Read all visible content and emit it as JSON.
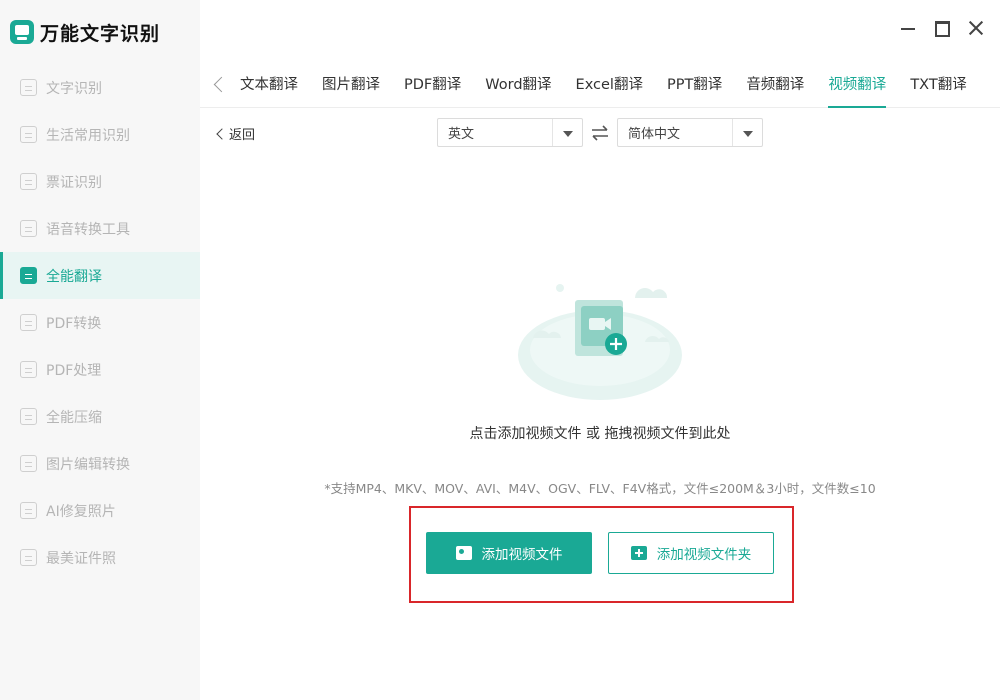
{
  "app": {
    "title": "万能文字识别"
  },
  "sidebar": {
    "items": [
      {
        "label": "文字识别",
        "active": false
      },
      {
        "label": "生活常用识别",
        "active": false
      },
      {
        "label": "票证识别",
        "active": false
      },
      {
        "label": "语音转换工具",
        "active": false
      },
      {
        "label": "全能翻译",
        "active": true
      },
      {
        "label": "PDF转换",
        "active": false
      },
      {
        "label": "PDF处理",
        "active": false
      },
      {
        "label": "全能压缩",
        "active": false
      },
      {
        "label": "图片编辑转换",
        "active": false
      },
      {
        "label": "AI修复照片",
        "active": false
      },
      {
        "label": "最美证件照",
        "active": false
      }
    ]
  },
  "tabs": [
    {
      "label": "文本翻译",
      "active": false
    },
    {
      "label": "图片翻译",
      "active": false
    },
    {
      "label": "PDF翻译",
      "active": false
    },
    {
      "label": "Word翻译",
      "active": false
    },
    {
      "label": "Excel翻译",
      "active": false
    },
    {
      "label": "PPT翻译",
      "active": false
    },
    {
      "label": "音频翻译",
      "active": false
    },
    {
      "label": "视频翻译",
      "active": true
    },
    {
      "label": "TXT翻译",
      "active": false
    }
  ],
  "toolbar": {
    "back_label": "返回",
    "source_lang": "英文",
    "target_lang": "简体中文"
  },
  "upload": {
    "hint": "点击添加视频文件 或 拖拽视频文件到此处",
    "formats": "*支持MP4、MKV、MOV、AVI、M4V、OGV、FLV、F4V格式，文件≤200M＆3小时，文件数≤10",
    "add_file_label": "添加视频文件",
    "add_folder_label": "添加视频文件夹"
  },
  "colors": {
    "accent": "#1aa995",
    "highlight": "#d9262a"
  }
}
